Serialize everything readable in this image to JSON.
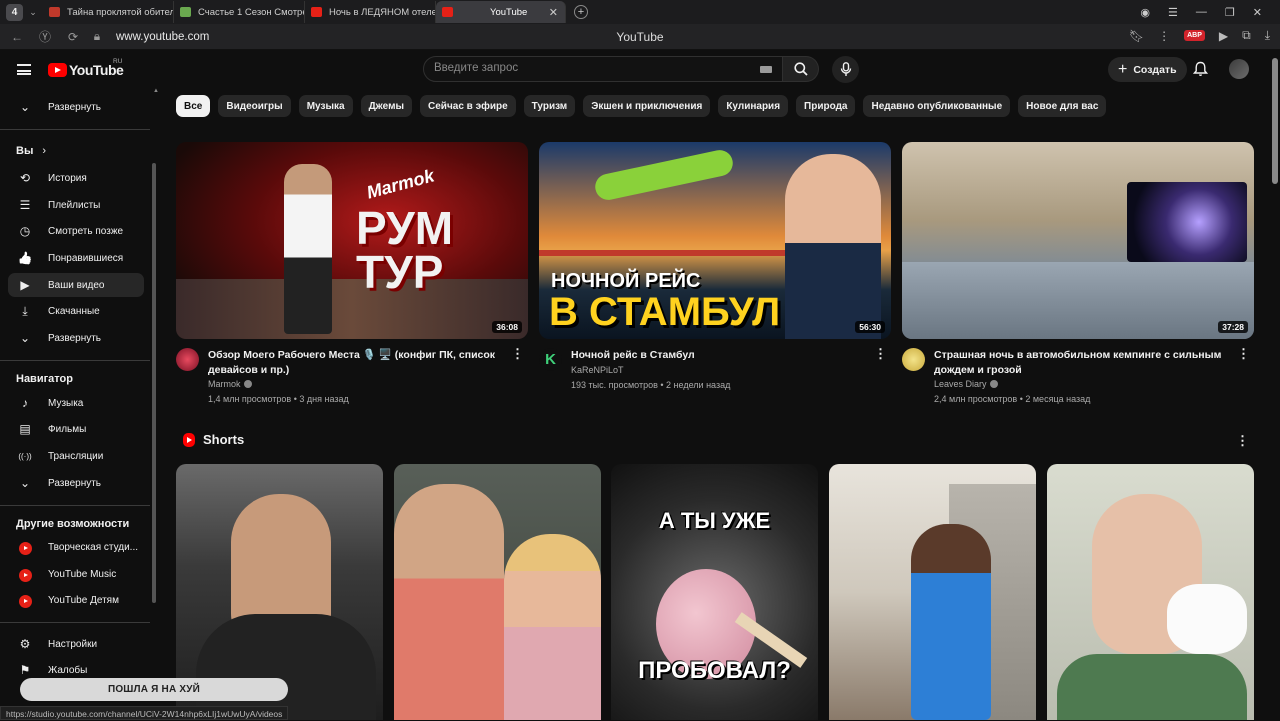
{
  "browser": {
    "tab_count": "4",
    "tabs": [
      {
        "title": "Тайна проклятой обител",
        "color": "#c0392b"
      },
      {
        "title": "Счастье 1 Сезон Смотре",
        "color": "#6aa84f"
      },
      {
        "title": "Ночь в ЛЕДЯНОМ отеле",
        "color": "#e62117"
      },
      {
        "title": "YouTube",
        "color": "#e62117"
      }
    ],
    "url": "www.youtube.com",
    "page_title": "YouTube",
    "abp": "ABP"
  },
  "header": {
    "logo_text": "YouTube",
    "logo_region": "RU",
    "search_placeholder": "Введите запрос",
    "create_label": "Создать"
  },
  "sidebar": {
    "expand_top": "Развернуть",
    "you_heading": "Вы",
    "you_items": [
      {
        "label": "История",
        "icon": "history-icon",
        "glyph": "⟲"
      },
      {
        "label": "Плейлисты",
        "icon": "playlists-icon",
        "glyph": "☰"
      },
      {
        "label": "Смотреть позже",
        "icon": "watch-later-icon",
        "glyph": "◷"
      },
      {
        "label": "Понравившиеся",
        "icon": "like-icon",
        "glyph": "👍"
      },
      {
        "label": "Ваши видео",
        "icon": "your-videos-icon",
        "glyph": "▶"
      },
      {
        "label": "Скачанные",
        "icon": "download-icon",
        "glyph": "⤓"
      },
      {
        "label": "Развернуть",
        "icon": "chevron-down-icon",
        "glyph": "⌄"
      }
    ],
    "navigator_heading": "Навигатор",
    "nav_items": [
      {
        "label": "Музыка",
        "icon": "music-icon",
        "glyph": "♪"
      },
      {
        "label": "Фильмы",
        "icon": "films-icon",
        "glyph": "▤"
      },
      {
        "label": "Трансляции",
        "icon": "live-icon",
        "glyph": "((·))"
      },
      {
        "label": "Развернуть",
        "icon": "chevron-down-icon",
        "glyph": "⌄"
      }
    ],
    "more_heading": "Другие возможности",
    "more_items": [
      {
        "label": "Творческая студи..."
      },
      {
        "label": "YouTube Music"
      },
      {
        "label": "YouTube Детям"
      }
    ],
    "settings_items": [
      {
        "label": "Настройки",
        "icon": "settings-icon",
        "glyph": "⚙"
      },
      {
        "label": "Жалобы",
        "icon": "flag-icon",
        "glyph": "⚑"
      }
    ]
  },
  "chips": [
    "Все",
    "Видеоигры",
    "Музыка",
    "Джемы",
    "Сейчас в эфире",
    "Туризм",
    "Экшен и приключения",
    "Кулинария",
    "Природа",
    "Недавно опубликованные",
    "Новое для вас"
  ],
  "videos": [
    {
      "title": "Обзор Моего Рабочего Места 🎙️ 🖥️ (конфиг ПК, список девайсов и пр.)",
      "channel": "Marmok",
      "stats": "1,4 млн просмотров • 3 дня назад",
      "duration": "36:08",
      "thumb_text_1": "Marmok",
      "thumb_text_2": "РУМ ТУР"
    },
    {
      "title": "Ночной рейс в Стамбул",
      "channel": "KaReNPiLoT",
      "stats": "193 тыс. просмотров • 2 недели назад",
      "duration": "56:30",
      "thumb_text_1": "НОЧНОЙ РЕЙС",
      "thumb_text_2": "В СТАМБУЛ"
    },
    {
      "title": "Страшная ночь в автомобильном кемпинге с сильным дождем и грозой",
      "channel": "Leaves Diary",
      "stats": "2,4 млн просмотров • 2 месяца назад",
      "duration": "37:28"
    }
  ],
  "shorts": {
    "heading": "Shorts",
    "items": [
      {
        "text_top": "",
        "text_bottom": ""
      },
      {
        "text_top": "",
        "text_bottom": ""
      },
      {
        "text_top": "А ТЫ УЖЕ",
        "text_bottom": "ПРОБОВАЛ?"
      },
      {
        "text_top": "",
        "text_bottom": ""
      },
      {
        "text_top": "",
        "text_bottom": ""
      }
    ]
  },
  "status_url": "https://studio.youtube.com/channel/UCiV-2W14nhp6xLIj1wUwUyA/videos",
  "subtitle_overlay": "ПОШЛА Я НА ХУЙ"
}
